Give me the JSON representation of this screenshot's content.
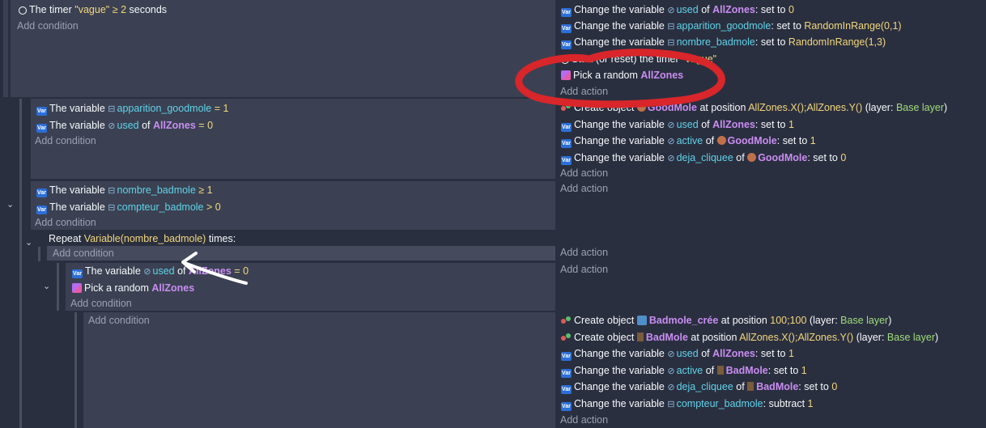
{
  "add_condition": "Add condition",
  "add_action": "Add action",
  "event1": {
    "cond": {
      "prefix": "The timer",
      "timer": "\"vague\"",
      "op": "≥",
      "val": "2",
      "suffix": "seconds"
    },
    "actions": [
      {
        "pre": "Change the variable",
        "var": "used",
        "mid": "of",
        "obj": "AllZones",
        "sep": ":",
        "post": "set to",
        "val": "0"
      },
      {
        "pre": "Change the variable",
        "var": "apparition_goodmole",
        "sep": ":",
        "post": "set to",
        "val": "RandomInRange(0,1)"
      },
      {
        "pre": "Change the variable",
        "var": "nombre_badmole",
        "sep": ":",
        "post": "set to",
        "val": "RandomInRange(1,3)"
      },
      {
        "pre": "Start (or reset) the timer",
        "val": "\"vague\""
      },
      {
        "pre": "Pick a random",
        "obj": "AllZones"
      }
    ]
  },
  "event2": {
    "conds": [
      {
        "pre": "The variable",
        "var": "apparition_goodmole",
        "op": "=",
        "val": "1"
      },
      {
        "pre": "The variable",
        "var": "used",
        "mid": "of",
        "obj": "AllZones",
        "op": "=",
        "val": "0"
      }
    ],
    "actions": [
      {
        "pre": "Create object",
        "obj": "GoodMole",
        "mid": "at position",
        "val": "AllZones.X();AllZones.Y()",
        "lp": "(layer:",
        "layer": "Base layer",
        "rp": ")"
      },
      {
        "pre": "Change the variable",
        "var": "used",
        "mid": "of",
        "obj": "AllZones",
        "sep": ":",
        "post": "set to",
        "val": "1"
      },
      {
        "pre": "Change the variable",
        "var": "active",
        "mid": "of",
        "obj": "GoodMole",
        "sep": ":",
        "post": "set to",
        "val": "1"
      },
      {
        "pre": "Change the variable",
        "var": "deja_cliquee",
        "mid": "of",
        "obj": "GoodMole",
        "sep": ":",
        "post": "set to",
        "val": "0"
      }
    ]
  },
  "event3": {
    "conds": [
      {
        "pre": "The variable",
        "var": "nombre_badmole",
        "op": "≥",
        "val": "1"
      },
      {
        "pre": "The variable",
        "var": "compteur_badmole",
        "op": ">",
        "val": "0"
      }
    ]
  },
  "repeat": {
    "pre": "Repeat",
    "expr": "Variable(nombre_badmole)",
    "post": "times:"
  },
  "sub1": {
    "cond": {
      "pre": "The variable",
      "var": "used",
      "mid": "of",
      "obj": "AllZones",
      "op": "=",
      "val": "0"
    },
    "pick": {
      "pre": "Pick a random",
      "obj": "AllZones"
    }
  },
  "sub2": {
    "actions": [
      {
        "pre": "Create object",
        "obj": "Badmole_crée",
        "mid": "at position",
        "val": "100;100",
        "lp": "(layer:",
        "layer": "Base layer",
        "rp": ")"
      },
      {
        "pre": "Create object",
        "obj": "BadMole",
        "mid": "at position",
        "val": "AllZones.X();AllZones.Y()",
        "lp": "(layer:",
        "layer": "Base layer",
        "rp": ")"
      },
      {
        "pre": "Change the variable",
        "var": "used",
        "mid": "of",
        "obj": "AllZones",
        "sep": ":",
        "post": "set to",
        "val": "1"
      },
      {
        "pre": "Change the variable",
        "var": "active",
        "mid": "of",
        "obj": "BadMole",
        "sep": ":",
        "post": "set to",
        "val": "1"
      },
      {
        "pre": "Change the variable",
        "var": "deja_cliquee",
        "mid": "of",
        "obj": "BadMole",
        "sep": ":",
        "post": "set to",
        "val": "0"
      },
      {
        "pre": "Change the variable",
        "var": "compteur_badmole",
        "sep": ":",
        "post": "subtract",
        "val": "1"
      }
    ]
  },
  "colors": {
    "panel": "#3b4152",
    "background": "#2a2f3f",
    "variable": "#5fd3ea",
    "object": "#c98df2",
    "value": "#f2d77c",
    "annotation_red": "#d8262a",
    "annotation_white": "#ffffff"
  }
}
